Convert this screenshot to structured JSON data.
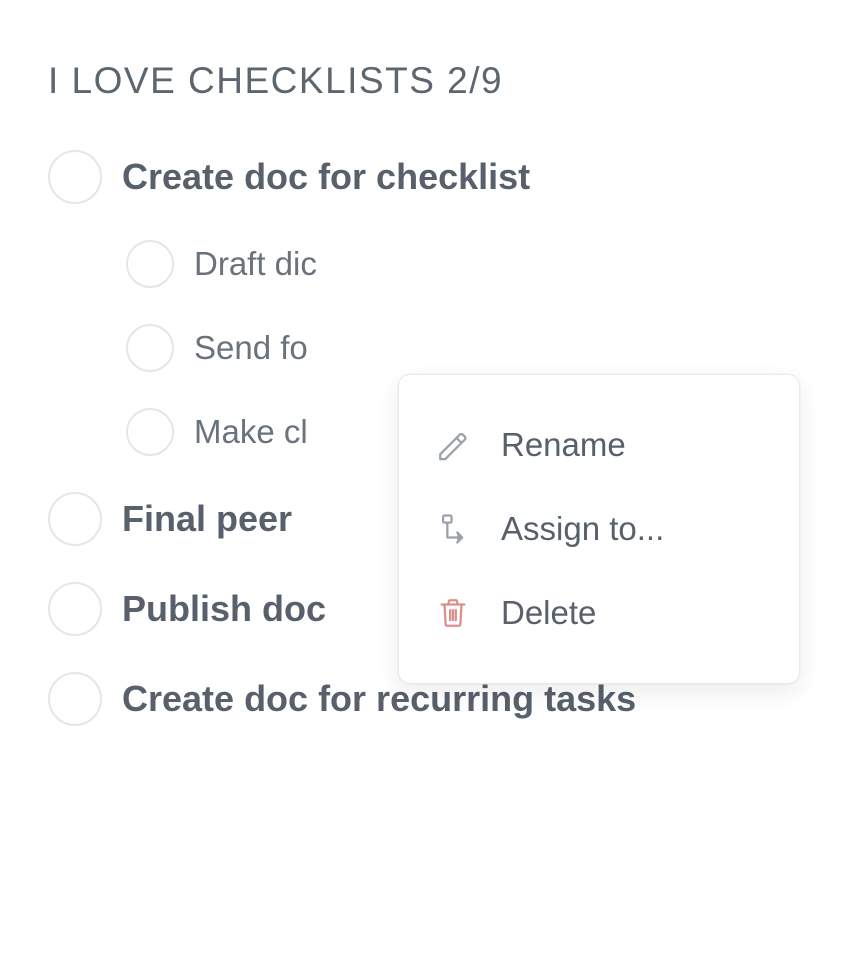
{
  "checklist": {
    "title": "I LOVE CHECKLISTS 2/9",
    "items": [
      {
        "label": "Create doc for checklist",
        "level": 0
      },
      {
        "label": "Draft dic",
        "level": 1
      },
      {
        "label": "Send fo",
        "level": 1
      },
      {
        "label": "Make cl",
        "level": 1
      },
      {
        "label": "Final peer",
        "level": 0
      },
      {
        "label": "Publish doc",
        "level": 0
      },
      {
        "label": "Create doc for recurring tasks",
        "level": 0
      }
    ]
  },
  "context_menu": {
    "items": [
      {
        "label": "Rename",
        "icon": "pencil"
      },
      {
        "label": "Assign to...",
        "icon": "assign"
      },
      {
        "label": "Delete",
        "icon": "trash"
      }
    ]
  }
}
